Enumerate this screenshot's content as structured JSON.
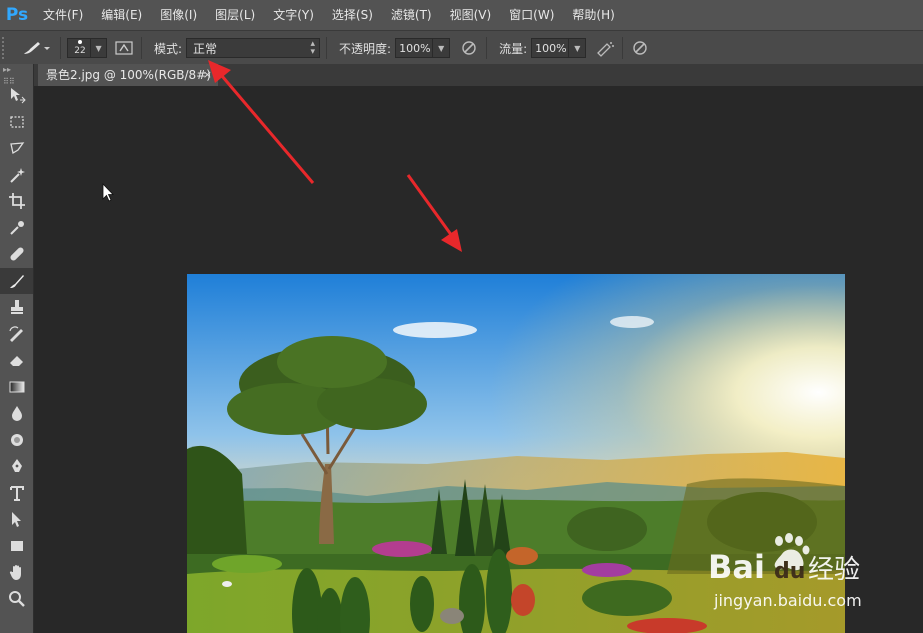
{
  "app": {
    "logo": "Ps"
  },
  "menu": [
    "文件(F)",
    "编辑(E)",
    "图像(I)",
    "图层(L)",
    "文字(Y)",
    "选择(S)",
    "滤镜(T)",
    "视图(V)",
    "窗口(W)",
    "帮助(H)"
  ],
  "options": {
    "brush_size": "22",
    "mode_label": "模式:",
    "mode_value": "正常",
    "opacity_label": "不透明度:",
    "opacity_value": "100%",
    "flow_label": "流量:",
    "flow_value": "100%"
  },
  "document": {
    "tab_title": "景色2.jpg @ 100%(RGB/8#)",
    "close_glyph": "×"
  },
  "tools": [
    "move-icon",
    "marquee-icon",
    "lasso-icon",
    "magic-wand-icon",
    "crop-icon",
    "eyedropper-icon",
    "healing-icon",
    "brush-icon",
    "stamp-icon",
    "history-brush-icon",
    "eraser-icon",
    "gradient-icon",
    "blur-icon",
    "dodge-icon",
    "pen-icon",
    "type-icon",
    "path-select-icon",
    "shape-icon",
    "hand-icon",
    "zoom-icon"
  ],
  "active_tool": "brush-icon",
  "annotations": {
    "arrow_color": "#e8282b"
  },
  "watermark": {
    "main": "Bai du 经验",
    "sub": "jingyan.baidu.com"
  }
}
